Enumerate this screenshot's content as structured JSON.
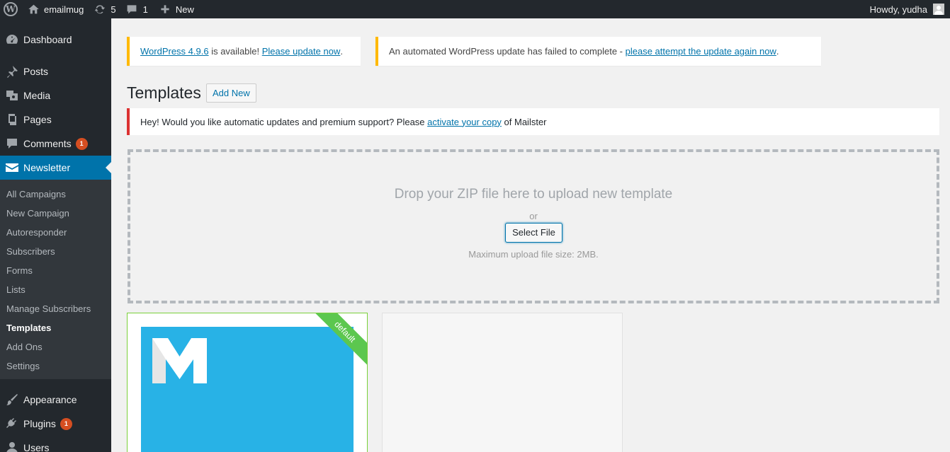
{
  "adminbar": {
    "site_name": "emailmug",
    "updates_count": "5",
    "comments_count": "1",
    "new_label": "New",
    "greeting": "Howdy, yudha",
    "wp_logo": "W"
  },
  "sidebar": {
    "items_top": [
      {
        "label": "Dashboard",
        "icon": "dashboard-icon"
      },
      {
        "label": "Posts",
        "icon": "pin-icon"
      },
      {
        "label": "Media",
        "icon": "media-icon"
      },
      {
        "label": "Pages",
        "icon": "pages-icon"
      },
      {
        "label": "Comments",
        "icon": "comment-icon",
        "badge": "1"
      },
      {
        "label": "Newsletter",
        "icon": "envelope-icon"
      }
    ],
    "submenu": [
      "All Campaigns",
      "New Campaign",
      "Autoresponder",
      "Subscribers",
      "Forms",
      "Lists",
      "Manage Subscribers",
      "Templates",
      "Add Ons",
      "Settings"
    ],
    "items_bottom": [
      {
        "label": "Appearance",
        "icon": "brush-icon"
      },
      {
        "label": "Plugins",
        "icon": "plugin-icon",
        "badge": "1"
      },
      {
        "label": "Users",
        "icon": "users-icon"
      }
    ]
  },
  "notices": {
    "update_link": "WordPress 4.9.6",
    "update_text": " is available! ",
    "update_action": "Please update now",
    "update_end": ".",
    "failed_text": "An automated WordPress update has failed to complete - ",
    "failed_link": "please attempt the update again now",
    "failed_end": "."
  },
  "page": {
    "title": "Templates",
    "add_new": "Add New"
  },
  "mailster_notice": {
    "text": "Hey! Would you like automatic updates and premium support? Please ",
    "link": "activate your copy",
    "end": " of Mailster"
  },
  "dropzone": {
    "title": "Drop your ZIP file here to upload new template",
    "or": "or",
    "button": "Select File",
    "max": "Maximum upload file size: 2MB."
  },
  "templates": {
    "ribbon": "default"
  },
  "colors": {
    "adminbar": "#23282d",
    "accent": "#0073aa",
    "warning": "#ffb900",
    "error": "#dc3232",
    "badge": "#d54e21",
    "template_bg": "#28b2e6",
    "ribbon": "#5cc74f"
  }
}
